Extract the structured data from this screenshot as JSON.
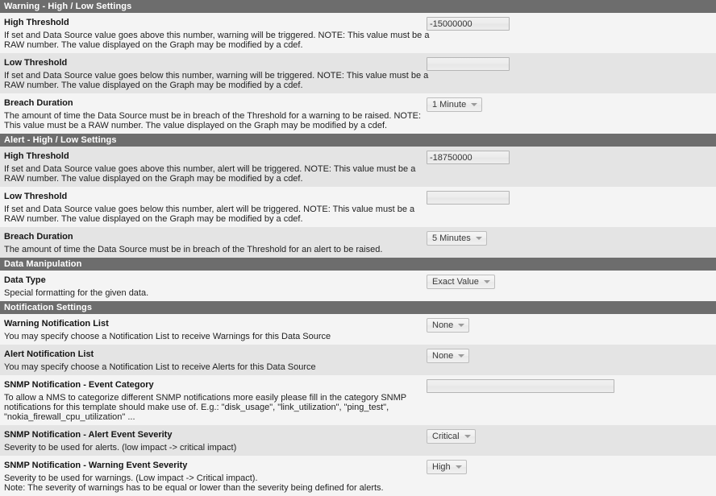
{
  "sections": [
    {
      "id": "warning-high-low",
      "title": "Warning - High / Low Settings",
      "fields": [
        {
          "id": "warning-high-threshold",
          "label": "High Threshold",
          "desc": "If set and Data Source value goes above this number, warning will be triggered. NOTE: This value must be a RAW number. The value displayed on the Graph may be modified by a cdef.",
          "control": "text",
          "value": "-15000000",
          "placeholder": ""
        },
        {
          "id": "warning-low-threshold",
          "label": "Low Threshold",
          "desc": "If set and Data Source value goes below this number, warning will be triggered. NOTE: This value must be a RAW number. The value displayed on the Graph may be modified by a cdef.",
          "control": "text",
          "value": "",
          "placeholder": ""
        },
        {
          "id": "warning-breach-duration",
          "label": "Breach Duration",
          "desc": "The amount of time the Data Source must be in breach of the Threshold for a warning to be raised. NOTE: This value must be a RAW number. The value displayed on the Graph may be modified by a cdef.",
          "control": "select",
          "value": "1 Minute"
        }
      ]
    },
    {
      "id": "alert-high-low",
      "title": "Alert - High / Low Settings",
      "fields": [
        {
          "id": "alert-high-threshold",
          "label": "High Threshold",
          "desc": "If set and Data Source value goes above this number, alert will be triggered. NOTE: This value must be a RAW number. The value displayed on the Graph may be modified by a cdef.",
          "control": "text",
          "value": "-18750000",
          "placeholder": ""
        },
        {
          "id": "alert-low-threshold",
          "label": "Low Threshold",
          "desc": "If set and Data Source value goes below this number, alert will be triggered. NOTE: This value must be a RAW number. The value displayed on the Graph may be modified by a cdef.",
          "control": "text",
          "value": "",
          "placeholder": ""
        },
        {
          "id": "alert-breach-duration",
          "label": "Breach Duration",
          "desc": "The amount of time the Data Source must be in breach of the Threshold for an alert to be raised.",
          "control": "select",
          "value": "5 Minutes"
        }
      ]
    },
    {
      "id": "data-manipulation",
      "title": "Data Manipulation",
      "fields": [
        {
          "id": "data-type",
          "label": "Data Type",
          "desc": "Special formatting for the given data.",
          "control": "select",
          "value": "Exact Value"
        }
      ]
    },
    {
      "id": "notification-settings",
      "title": "Notification Settings",
      "fields": [
        {
          "id": "warning-notification-list",
          "label": "Warning Notification List",
          "desc": "You may specify choose a Notification List to receive Warnings for this Data Source",
          "control": "select",
          "value": "None"
        },
        {
          "id": "alert-notification-list",
          "label": "Alert Notification List",
          "desc": "You may specify choose a Notification List to receive Alerts for this Data Source",
          "control": "select",
          "value": "None"
        },
        {
          "id": "snmp-event-category",
          "label": "SNMP Notification - Event Category",
          "desc": "To allow a NMS to categorize different SNMP notifications more easily please fill in the category SNMP notifications for this template should make use of. E.g.: \"disk_usage\", \"link_utilization\", \"ping_test\", \"nokia_firewall_cpu_utilization\" ...",
          "control": "text-long",
          "value": "",
          "placeholder": ""
        },
        {
          "id": "snmp-alert-event-severity",
          "label": "SNMP Notification - Alert Event Severity",
          "desc": "Severity to be used for alerts. (low impact -> critical impact)",
          "control": "select",
          "value": "Critical"
        },
        {
          "id": "snmp-warning-event-severity",
          "label": "SNMP Notification - Warning Event Severity",
          "desc": "Severity to be used for warnings. (Low impact -> Critical impact).\nNote: The severity of warnings has to be equal or lower than the severity being defined for alerts.",
          "control": "select",
          "value": "High"
        }
      ]
    }
  ],
  "colors": {
    "section_header_bg": "#6d6d6d",
    "row_light": "#f4f4f4",
    "row_dark": "#e4e4e4",
    "text": "#1a1a1a"
  }
}
